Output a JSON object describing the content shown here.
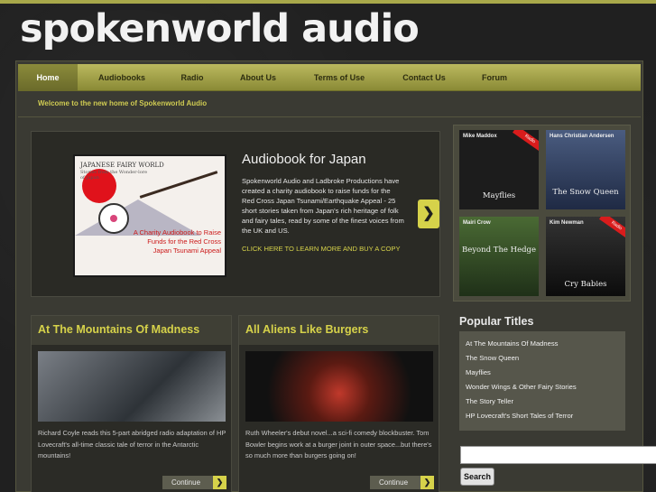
{
  "site": {
    "logo": "spokenworld audio"
  },
  "nav": [
    {
      "label": "Home"
    },
    {
      "label": "Audiobooks"
    },
    {
      "label": "Radio"
    },
    {
      "label": "About Us"
    },
    {
      "label": "Terms of Use"
    },
    {
      "label": "Contact Us"
    },
    {
      "label": "Forum"
    }
  ],
  "welcome": "Welcome to the new home of Spokenworld Audio",
  "feature": {
    "cover_title": "JAPANESE FAIRY WORLD",
    "cover_subtitle": "Stories from the Wonder-lore of Japan",
    "cover_text": "A Charity Audiobook to Raise Funds for the Red Cross Japan Tsunami Appeal",
    "title": "Audiobook for Japan",
    "description": "Spokenworld Audio and Ladbroke Productions have created a charity audiobook to raise funds for the Red Cross Japan Tsunami/Earthquake Appeal - 25 short stories taken from Japan's rich heritage of folk and fairy tales, read by some of the finest voices from the UK and US.",
    "link": "CLICK HERE TO LEARN MORE AND BUY A COPY",
    "next_icon": "chevron-right-icon"
  },
  "covers": [
    {
      "author": "Mike Maddox",
      "title": "Mayflies",
      "ribbon": "Radio",
      "color": "#1d1d1d"
    },
    {
      "author": "Hans Christian Andersen",
      "title": "The Snow Queen",
      "ribbon": "",
      "color": "#3a4a6a"
    },
    {
      "author": "Mairi Crow",
      "title": "Beyond The Hedge",
      "ribbon": "",
      "color": "#3c5a2a"
    },
    {
      "author": "Kim Newman",
      "title": "Cry Babies",
      "ribbon": "Radio",
      "color": "#141414"
    }
  ],
  "cards": [
    {
      "title": "At The Mountains Of Madness",
      "text": "Richard Coyle reads this 5-part abridged radio adaptation of HP Lovecraft's all-time classic tale of terror in the Antarctic mountains!",
      "continue": "Continue"
    },
    {
      "title": "All Aliens Like Burgers",
      "text": "Ruth Wheeler's debut novel...a sci-fi comedy blockbuster. Tom Bowler begins work at a burger joint in outer space...but there's so much more than burgers going on!",
      "continue": "Continue"
    }
  ],
  "popular": {
    "heading": "Popular Titles",
    "items": [
      "At The Mountains Of Madness",
      "The Snow Queen",
      "Mayflies",
      "Wonder Wings & Other Fairy Stories",
      "The Story Teller",
      "HP Lovecraft's Short Tales of Terror"
    ]
  },
  "search": {
    "value": "",
    "button": "Search"
  }
}
